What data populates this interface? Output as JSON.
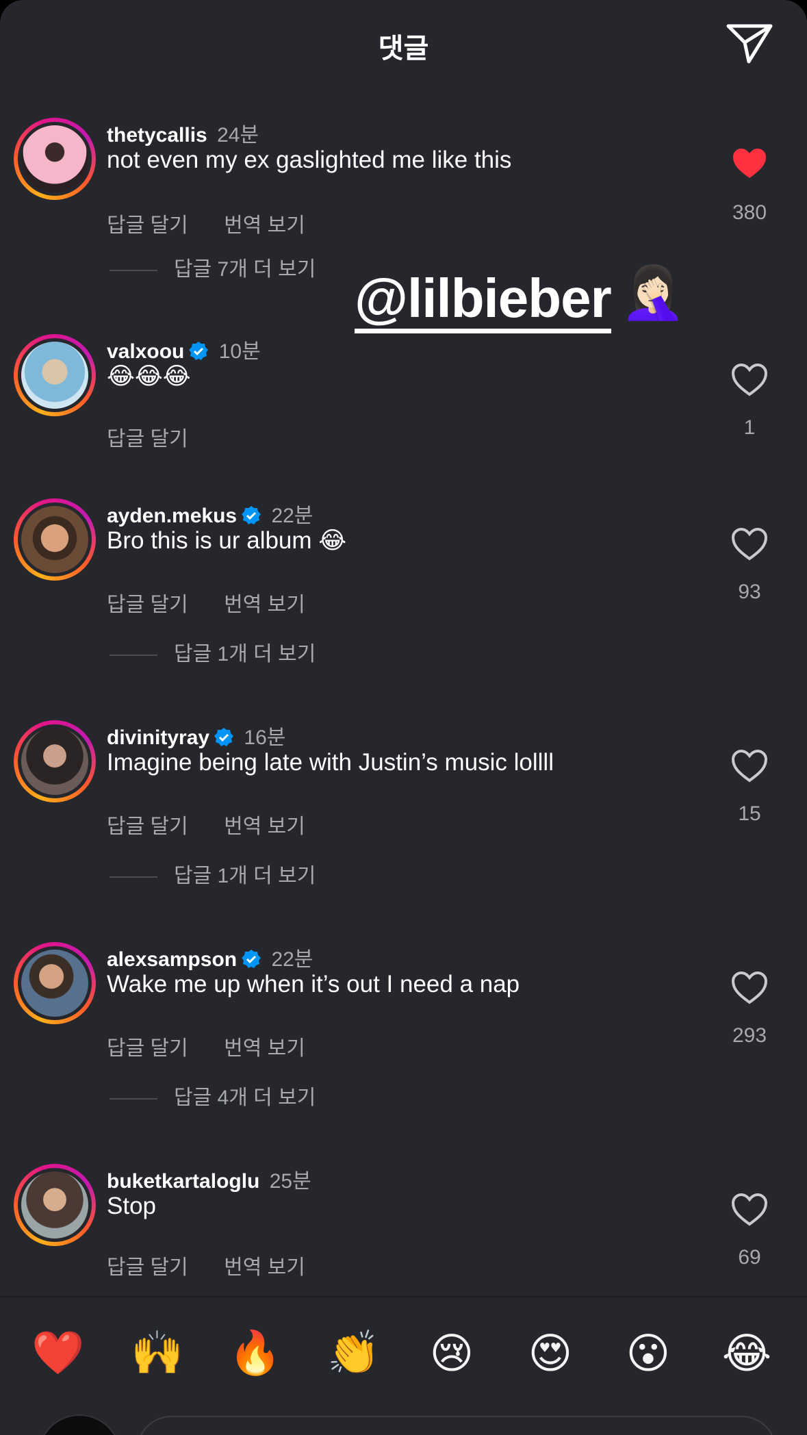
{
  "header": {
    "title": "댓글"
  },
  "sticker": {
    "handle": "@lilbieber",
    "emoji": "🤦🏻‍♀️"
  },
  "comments": [
    {
      "username": "thetycallis",
      "verified": false,
      "time": "24분",
      "text": "not even my ex gaslighted me like this",
      "reply_label": "답글 달기",
      "translate_label": "번역 보기",
      "more_replies": "답글 7개 더 보기",
      "likes": "380",
      "liked": true
    },
    {
      "username": "valxoou",
      "verified": true,
      "time": "10분",
      "text": "😂😂😂",
      "reply_label": "답글 달기",
      "likes": "1",
      "liked": false
    },
    {
      "username": "ayden.mekus",
      "verified": true,
      "time": "22분",
      "text": "Bro this is ur album 😂",
      "reply_label": "답글 달기",
      "translate_label": "번역 보기",
      "more_replies": "답글 1개 더 보기",
      "likes": "93",
      "liked": false
    },
    {
      "username": "divinityray",
      "verified": true,
      "time": "16분",
      "text": "Imagine being late with Justin’s music lollll",
      "reply_label": "답글 달기",
      "translate_label": "번역 보기",
      "more_replies": "답글 1개 더 보기",
      "likes": "15",
      "liked": false
    },
    {
      "username": "alexsampson",
      "verified": true,
      "time": "22분",
      "text": "Wake me up when it’s out I need a nap",
      "reply_label": "답글 달기",
      "translate_label": "번역 보기",
      "more_replies": "답글 4개 더 보기",
      "likes": "293",
      "liked": false
    },
    {
      "username": "buketkartaloglu",
      "verified": false,
      "time": "25분",
      "text": "Stop",
      "reply_label": "답글 달기",
      "translate_label": "번역 보기",
      "likes": "69",
      "liked": false
    }
  ],
  "quick_reactions": [
    "❤️",
    "🙌",
    "🔥",
    "👏",
    "😢",
    "😍",
    "😮",
    "😂"
  ],
  "colors": {
    "background": "#25272c",
    "accent_like": "#ff3040",
    "verified_blue": "#0095f6",
    "muted": "#a8a9ad"
  }
}
